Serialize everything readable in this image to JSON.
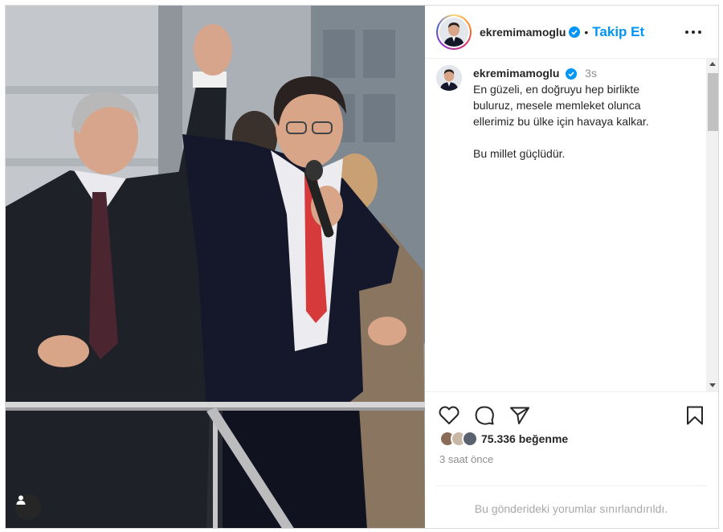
{
  "post": {
    "username": "ekremimamoglu",
    "follow_label": "Takip Et",
    "separator": "•",
    "verified_icon": "verified-badge-icon",
    "accent_color": "#0095f6"
  },
  "caption": {
    "username": "ekremimamoglu",
    "time": "3s",
    "lines": [
      "En güzeli, en doğruyu hep birlikte",
      "buluruz, mesele memleket olunca",
      "ellerimiz bu ülke için havaya kalkar.",
      "",
      "Bu millet güçlüdür."
    ]
  },
  "actions": {
    "likes_text": "75.336 beğenme",
    "posted_ago": "3 saat önce",
    "comments_notice": "Bu gönderideki yorumlar sınırlandırıldı.",
    "icons": [
      "heart-icon",
      "comment-icon",
      "share-icon",
      "bookmark-icon"
    ]
  }
}
